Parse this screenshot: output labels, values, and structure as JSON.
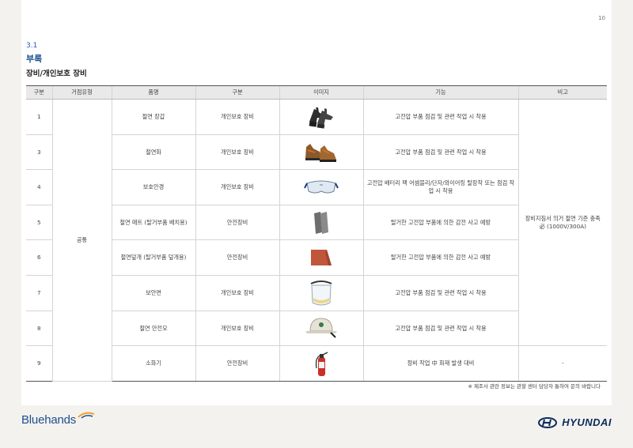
{
  "page_number": "10",
  "section": {
    "number": "3.1",
    "title": "부록"
  },
  "subtitle": "장비/개인보호 장비",
  "table": {
    "headers": [
      "구분",
      "거점유형",
      "품명",
      "구분",
      "이미지",
      "기능",
      "비고"
    ],
    "site_type": "공통",
    "rows": [
      {
        "no": "1",
        "name": "절연 장갑",
        "category": "개인보호 장비",
        "image": "insulated-gloves",
        "function": "고전압 부품 점검 및 관련 작업 시 착용"
      },
      {
        "no": "3",
        "name": "절연화",
        "category": "개인보호 장비",
        "image": "insulated-shoes",
        "function": "고전압 부품 점검 및 관련 작업 시 착용"
      },
      {
        "no": "4",
        "name": "보호안경",
        "category": "개인보호 장비",
        "image": "safety-goggles",
        "function": "고전압 배터리 팩 어셈블리/단자/와이어링 탈장착 또는 점검 작업 시 착용"
      },
      {
        "no": "5",
        "name": "절연 매트 (탈거부품 배치용)",
        "category": "안전장비",
        "image": "insulation-mat",
        "function": "탈거한 고전압 부품에 의한 감전 사고 예방"
      },
      {
        "no": "6",
        "name": "절연덮개 (탈거부품 덮개용)",
        "category": "안전장비",
        "image": "insulation-cover",
        "function": "탈거한 고전압 부품에 의한 감전 사고 예방"
      },
      {
        "no": "7",
        "name": "보안면",
        "category": "개인보호 장비",
        "image": "face-shield",
        "function": "고전압 부품 점검 및 관련 작업 시 착용"
      },
      {
        "no": "8",
        "name": "절연 안전모",
        "category": "개인보호 장비",
        "image": "safety-helmet",
        "function": "고전압 부품 점검 및 관련 작업 시 착용"
      },
      {
        "no": "9",
        "name": "소화기",
        "category": "안전장비",
        "image": "fire-extinguisher",
        "function": "정비 작업 中 화재 발생 대비"
      }
    ],
    "remark_main": "장비지침서 의거 절연 기준 충족 必 (1000V/300A)",
    "remark_last": "-"
  },
  "footnote": "※ 제조사 관련 정보는 관할 센터 담당자 통하여 문의 바랍니다",
  "brand_left": "Bluehands",
  "brand_right": "HYUNDAI",
  "colors": {
    "accent": "#1f4f8f",
    "link_blue": "#1f5fa8",
    "header_bg": "#e9e9e9",
    "swoosh": "#f0a030"
  }
}
